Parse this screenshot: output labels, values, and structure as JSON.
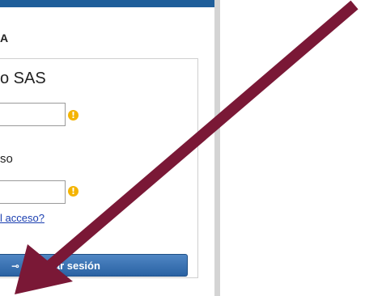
{
  "section": {
    "heading": "A"
  },
  "login": {
    "subtitle": "o SAS",
    "password_label": "so",
    "forgot_link": "l acceso?",
    "submit_label": "ciar sesión"
  },
  "icons": {
    "warning": "warning-icon",
    "key": "key-icon",
    "arrow": "arrow-annotation"
  },
  "colors": {
    "header_bar": "#1f5e9a",
    "button": "#2a62a3",
    "warning": "#f4b400",
    "link": "#1a3eb0",
    "arrow": "#7a1836"
  }
}
